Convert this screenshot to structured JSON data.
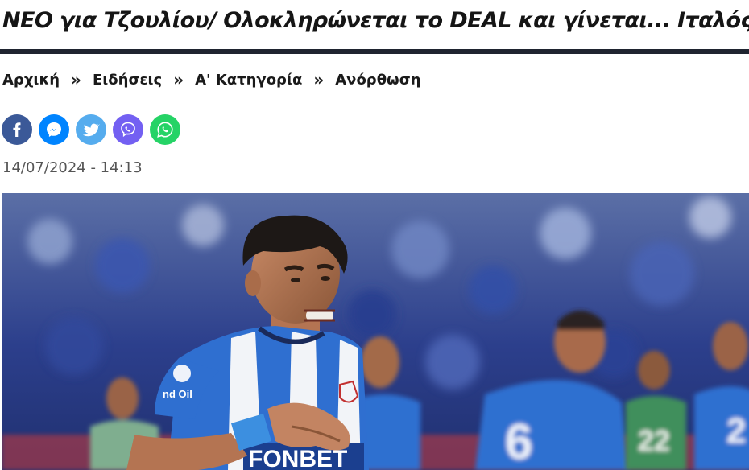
{
  "article": {
    "title": "ΝΕΟ για Τζουλίου/ Ολοκληρώνεται το DEAL και γίνεται... Ιταλός!",
    "date": "14/07/2024 - 14:13"
  },
  "breadcrumb": {
    "items": [
      {
        "label": "Αρχική"
      },
      {
        "label": "Ειδήσεις"
      },
      {
        "label": "Α' Κατηγορία"
      },
      {
        "label": "Ανόρθωση"
      }
    ],
    "separator": "»"
  },
  "share": {
    "buttons": [
      {
        "icon": "facebook-icon",
        "color": "#3b5998"
      },
      {
        "icon": "messenger-icon",
        "color": "#0084ff"
      },
      {
        "icon": "twitter-icon",
        "color": "#55acee"
      },
      {
        "icon": "viber-icon",
        "color": "#7360f2"
      },
      {
        "icon": "whatsapp-icon",
        "color": "#25d366"
      }
    ]
  },
  "hero_image": {
    "shirt_text": {
      "sponsor_left": "nd Oil",
      "sponsor_front": "FONBET",
      "player_number_1": "6",
      "player_number_2": "2",
      "player_number_3": "22"
    },
    "colors": {
      "kit_blue": "#2f6fd0",
      "kit_white": "#f2f4f8",
      "crowd": "#2a3f8a"
    }
  }
}
